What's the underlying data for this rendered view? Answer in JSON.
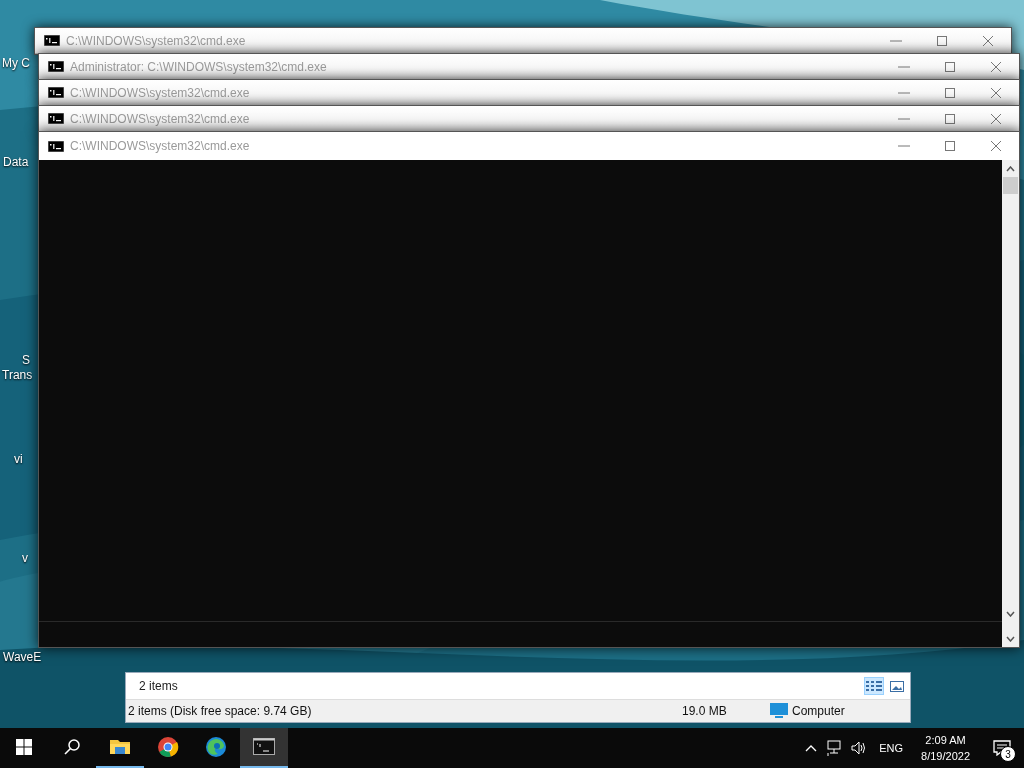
{
  "desktop_icons": [
    {
      "label": "My C"
    },
    {
      "label": "Data"
    },
    {
      "label": "S"
    },
    {
      "label": "Trans"
    },
    {
      "label": "vi"
    },
    {
      "label": "v"
    },
    {
      "label": "WaveE"
    }
  ],
  "windows": [
    {
      "title": "C:\\WINDOWS\\system32\\cmd.exe"
    },
    {
      "title": "Administrator: C:\\WINDOWS\\system32\\cmd.exe"
    },
    {
      "title": "C:\\WINDOWS\\system32\\cmd.exe"
    },
    {
      "title": "C:\\WINDOWS\\system32\\cmd.exe"
    },
    {
      "title": "C:\\WINDOWS\\system32\\cmd.exe"
    }
  ],
  "explorer": {
    "item_count": "2 items",
    "status": "2 items (Disk free space: 9.74 GB)",
    "size": "19.0 MB",
    "location": "Computer"
  },
  "taskbar": {
    "apps": [
      {
        "kind": "explorer",
        "running": true,
        "selected": false
      },
      {
        "kind": "chrome",
        "running": false,
        "selected": false
      },
      {
        "kind": "edge",
        "running": false,
        "selected": false
      },
      {
        "kind": "cmd",
        "running": true,
        "selected": true
      }
    ],
    "language": "ENG",
    "time": "2:09 AM",
    "date": "8/19/2022",
    "notifications": "3"
  }
}
